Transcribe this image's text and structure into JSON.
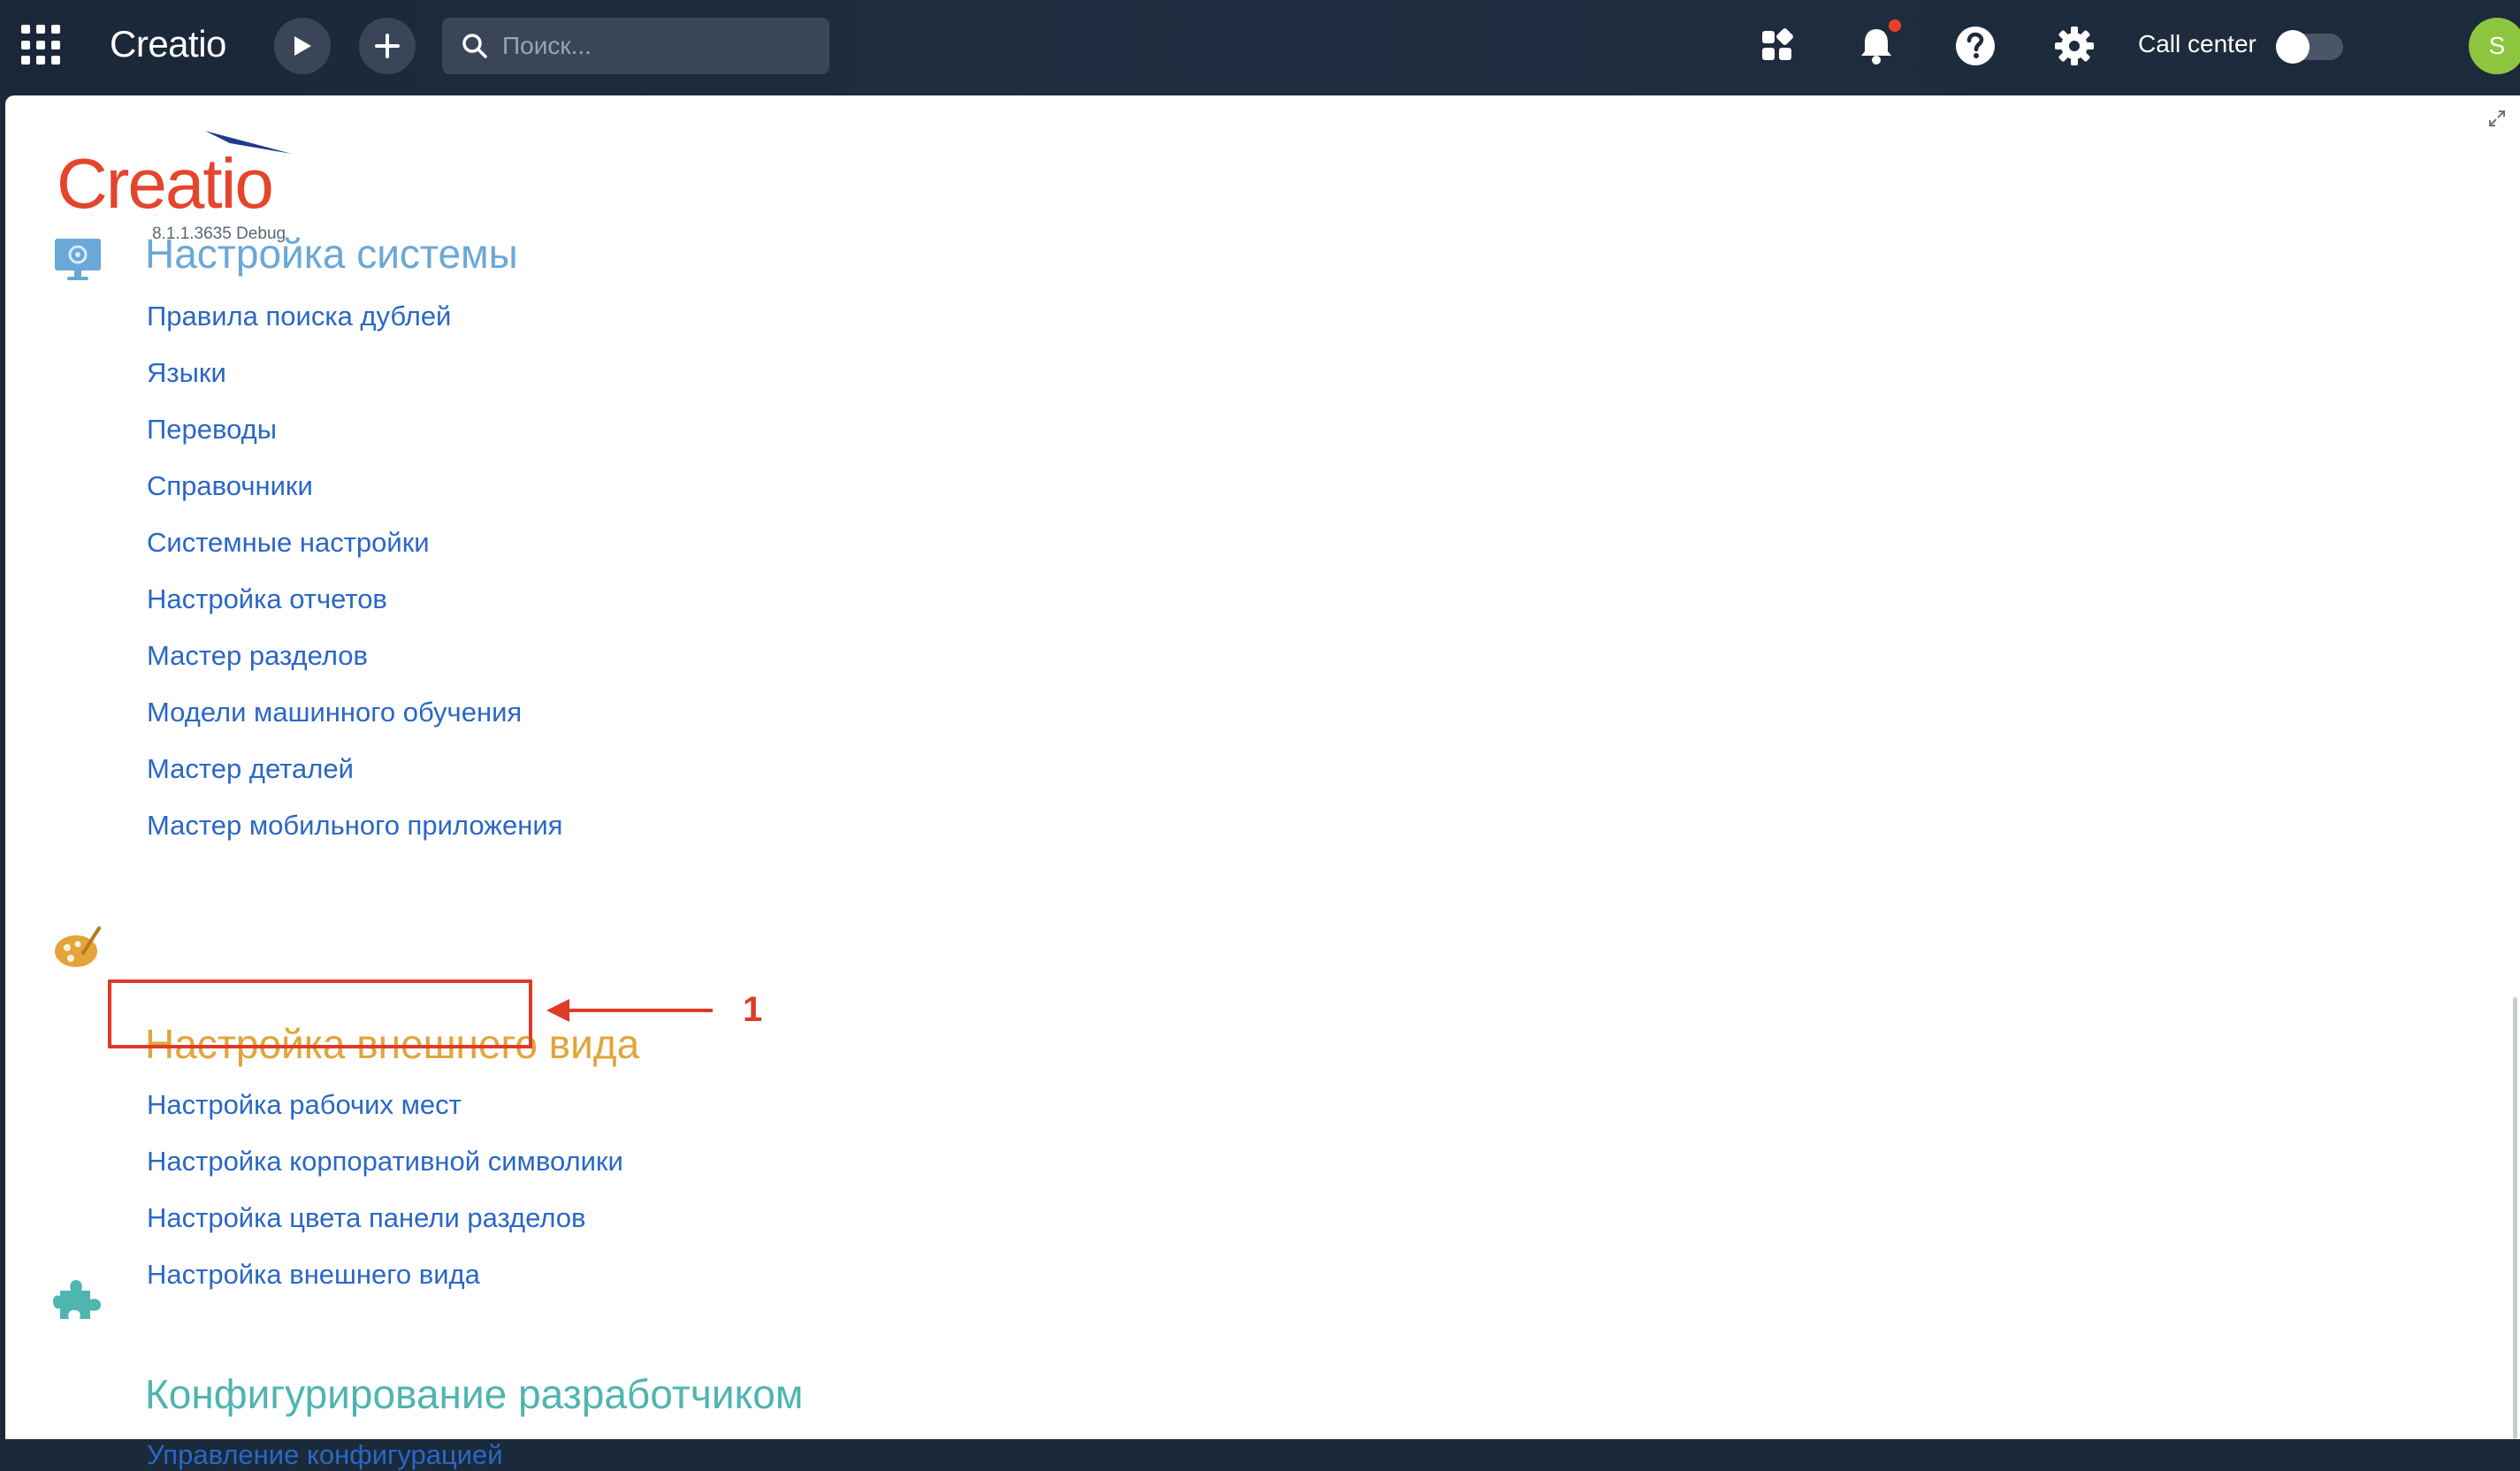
{
  "topbar": {
    "brand": "Creatio",
    "search_placeholder": "Поиск...",
    "callcenter_label": "Call center",
    "avatar_letter": "S"
  },
  "logo": {
    "text": "Creatio",
    "version": "8.1.1.3635 Debug"
  },
  "groups": [
    {
      "title": "Настройка системы",
      "color": "#6aa8d8",
      "icon": "monitor-gear-icon",
      "links": [
        "Правила поиска дублей",
        "Языки",
        "Переводы",
        "Справочники",
        "Системные настройки",
        "Настройка отчетов",
        "Мастер разделов",
        "Модели машинного обучения",
        "Мастер деталей",
        "Мастер мобильного приложения"
      ]
    },
    {
      "title": "Настройка внешнего вида",
      "color": "#e3a43a",
      "icon": "palette-icon",
      "links": [
        "Настройка рабочих мест",
        "Настройка корпоративной символики",
        "Настройка цвета панели разделов",
        "Настройка внешнего вида"
      ]
    },
    {
      "title": "Конфигурирование разработчиком",
      "color": "#4fb5b0",
      "icon": "puzzle-icon",
      "links": [
        "Управление конфигурацией"
      ]
    }
  ],
  "annotation": {
    "callout_number": "1",
    "color": "#e03a26"
  }
}
